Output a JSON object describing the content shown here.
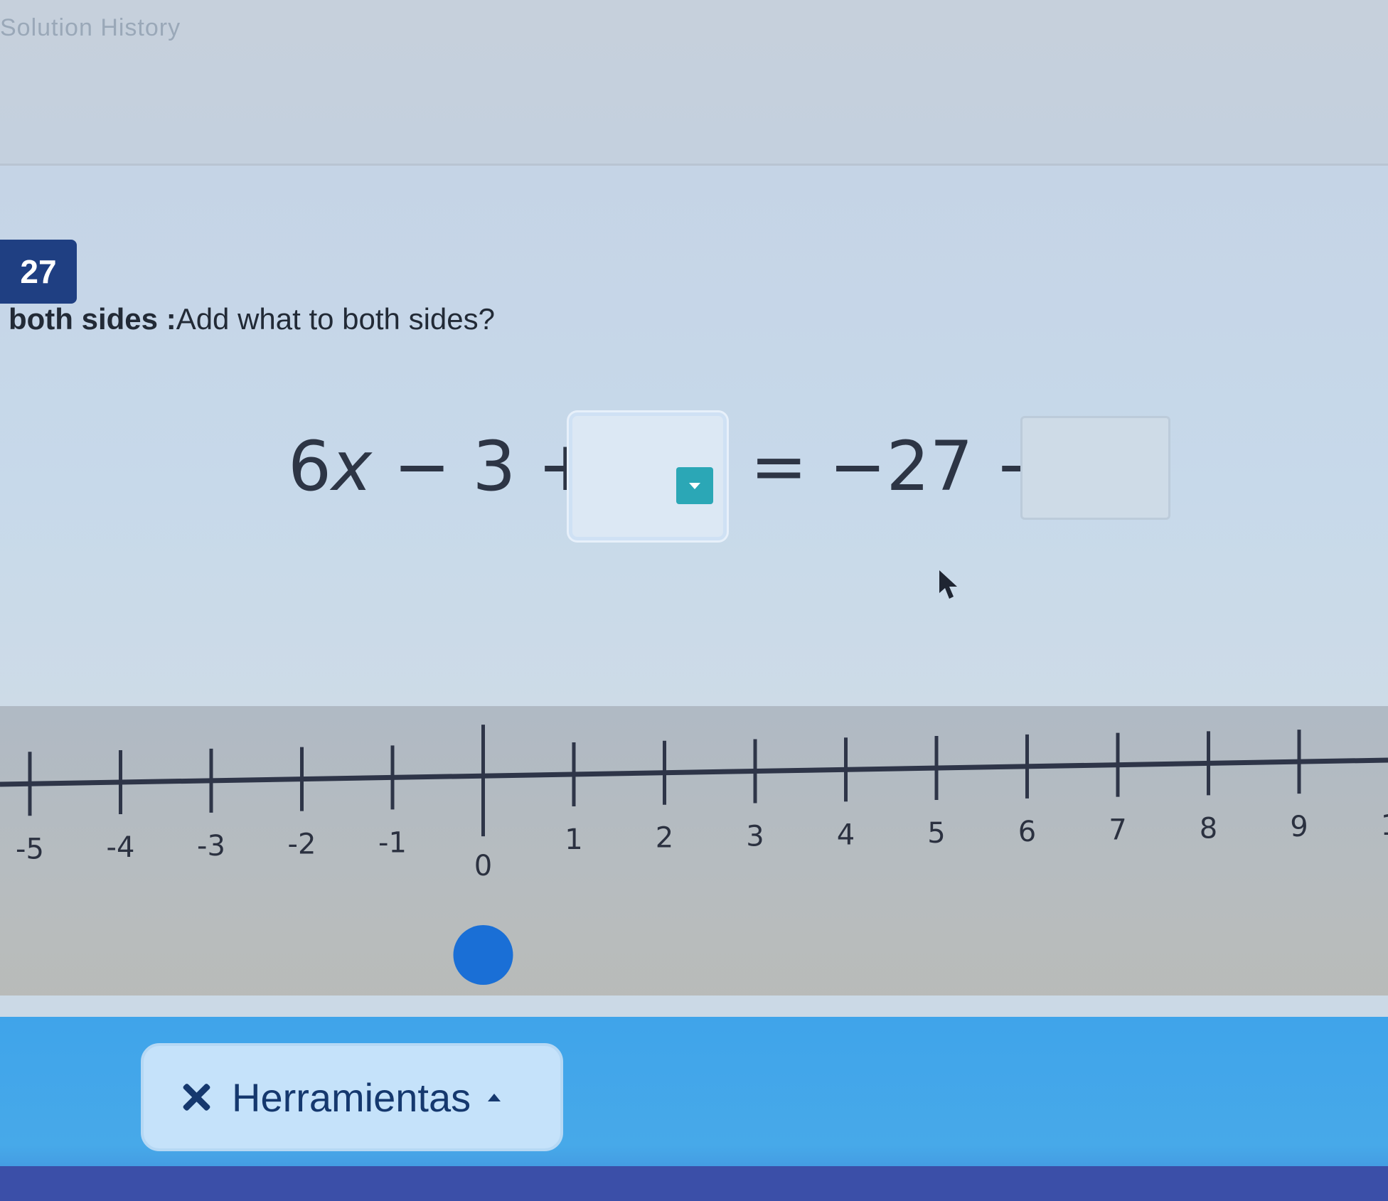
{
  "header": {
    "title": "Solution History"
  },
  "step": {
    "number": "27",
    "prompt_bold": "both sides :",
    "prompt_text": "Add what to both sides?"
  },
  "equation": {
    "lhs_coef": "6",
    "lhs_var": "x",
    "lhs_rest": " − 3 +",
    "rhs": "= −27 +",
    "answer_value": "",
    "second_box_value": ""
  },
  "number_line": {
    "tick_labels": [
      "-5",
      "-4",
      "-3",
      "-2",
      "-1",
      "0",
      "1",
      "2",
      "3",
      "4",
      "5",
      "6",
      "7",
      "8",
      "9",
      "1"
    ],
    "selected_value": 0
  },
  "footer": {
    "tools_label": "Herramientas"
  },
  "colors": {
    "badge": "#1f3f82",
    "dropdown": "#2ba7b6",
    "point": "#1a6fd6",
    "tools_bar": "#42a6ea"
  },
  "icons": [
    "dropdown-caret-icon",
    "mouse-cursor-icon",
    "tools-icon",
    "caret-up-icon"
  ]
}
